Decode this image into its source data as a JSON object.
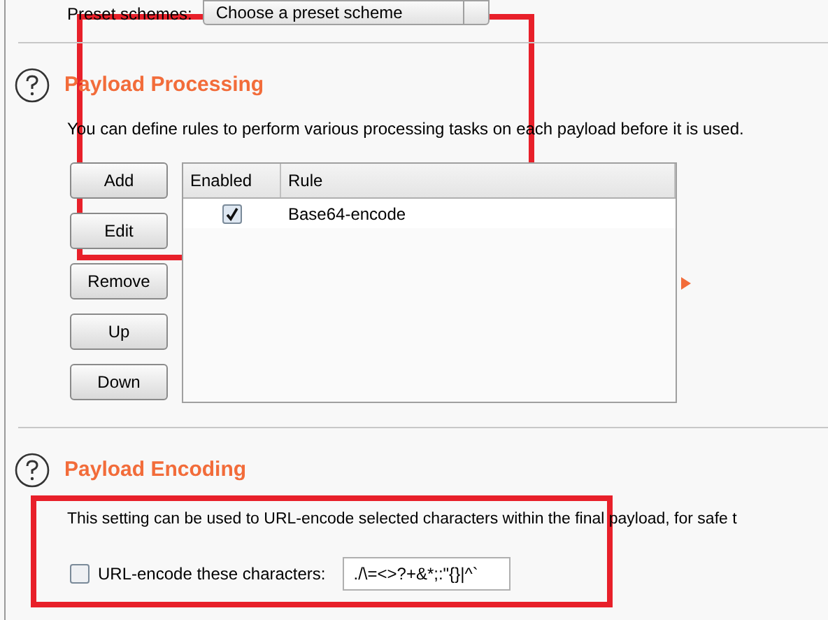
{
  "preset": {
    "label": "Preset schemes:",
    "value": "Choose a preset scheme"
  },
  "processing": {
    "title": "Payload Processing",
    "description": "You can define rules to perform various processing tasks on each payload before it is used.",
    "buttons": [
      "Add",
      "Edit",
      "Remove",
      "Up",
      "Down"
    ],
    "table": {
      "columns": [
        "Enabled",
        "Rule"
      ],
      "rows": [
        {
          "enabled": true,
          "rule": "Base64-encode"
        }
      ]
    }
  },
  "encoding": {
    "title": "Payload Encoding",
    "description": "This setting can be used to URL-encode selected characters within the final payload, for safe t",
    "checkbox": {
      "label": "URL-encode these characters:",
      "checked": false
    },
    "value": "./\\=<>?+&*;:\"{}|^`"
  }
}
